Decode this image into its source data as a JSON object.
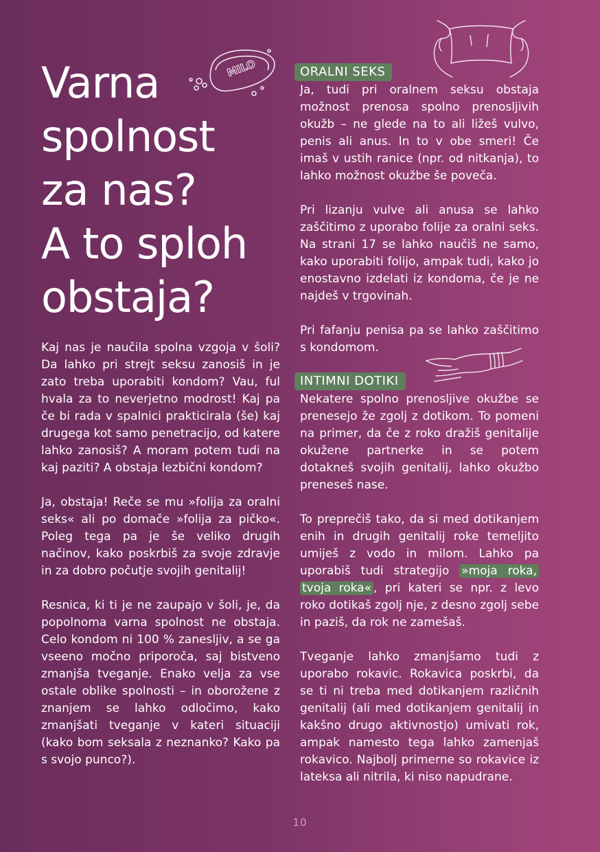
{
  "title_lines": [
    "Varna",
    "spolnost",
    "za nas?",
    "A to sploh",
    "obstaja?"
  ],
  "soap_label": "MILO",
  "left_column": [
    "Kaj nas je naučila spolna vzgoja v šoli? Da lahko pri strejt seksu zanosiš in je zato treba uporabiti kondom? Vau, ful hvala za to neverjetno modrost! Kaj pa če bi rada v spalnici prakticirala (še) kaj drugega kot samo penetracijo, od katere lahko zanosiš? A moram potem tudi na kaj paziti? A obstaja lezbični kondom?",
    "Ja, obstaja! Reče se mu »folija za oralni seks« ali po domače »folija za pičko«. Poleg tega pa je še veliko drugih načinov, kako poskrbiš za svoje zdravje in za dobro počutje svojih genitalij!",
    "Resnica, ki ti je ne zaupajo v šoli, je, da popolnoma varna spolnost ne obstaja. Celo kondom ni 100 % zanesljiv, a se ga vseeno močno priporoča, saj bistveno zmanjša tveganje. Enako velja za vse ostale oblike spolnosti – in oborožene z znanjem se lahko odločimo, kako zmanjšati tveganje v kateri situaciji (kako bom seksala z neznanko? Kako pa s svojo punco?)."
  ],
  "section1": {
    "heading": "ORALNI SEKS",
    "paragraphs": [
      "Ja, tudi pri oralnem seksu obstaja možnost prenosa spolno prenosljivih okužb – ne glede na to ali ližeš vulvo, penis ali anus. In to v obe smeri! Če imaš v ustih ranice (npr. od nitkanja), to lahko možnost okužbe še poveča.",
      "Pri lizanju vulve ali anusa se lahko zaščitimo z uporabo folije za oralni seks. Na strani 17 se lahko naučiš ne samo, kako uporabiti folijo, ampak tudi, kako jo enostavno izdelati iz kondoma, če je ne najdeš v trgovinah.",
      "Pri fafanju penisa pa se lahko zaščitimo s kondomom."
    ]
  },
  "section2": {
    "heading": "INTIMNI DOTIKI",
    "p1": "Nekatere spolno prenosljive okužbe se prenesejo že zgolj z dotikom. To pomeni na primer, da če z roko dražiš genitalije okužene partnerke in se potem dotakneš svojih genitalij, lahko okužbo preneseš nase.",
    "p2_before": "To preprečiš tako, da si med dotikanjem enih in drugih genitalij roke temeljito umiješ z vodo in milom. Lahko pa uporabiš tudi strategijo ",
    "p2_highlight_a": "»moja roka,",
    "p2_highlight_b": "tvoja roka«",
    "p2_after": ", pri kateri se npr. z levo roko dotikaš zgolj nje, z desno zgolj sebe in paziš, da rok ne zamešaš.",
    "p3": "Tveganje lahko zmanjšamo tudi z uporabo rokavic. Rokavica poskrbi, da se ti ni treba med dotikanjem različnih genitalij (ali med dotikanjem genitalij in kakšno drugo aktivnostjo) umivati rok, ampak namesto tega lahko zamenjaš rokavico. Najbolj primerne so rokavice iz lateksa ali nitrila, ki niso napudrane."
  },
  "page_number": "10",
  "colors": {
    "background_left": "#6b2d5c",
    "background_right": "#a3457b",
    "heading_bg": "#5f7e5c",
    "text": "#ffffff"
  }
}
